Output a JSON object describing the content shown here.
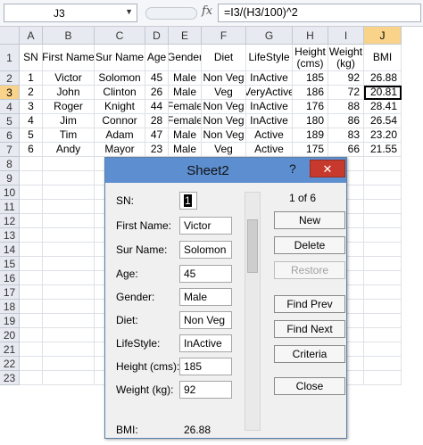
{
  "formula_bar": {
    "name_box": "J3",
    "fx": "fx",
    "formula": "=I3/(H3/100)^2"
  },
  "columns": [
    "A",
    "B",
    "C",
    "D",
    "E",
    "F",
    "G",
    "H",
    "I",
    "J"
  ],
  "rows": [
    "1",
    "2",
    "3",
    "4",
    "5",
    "6",
    "7",
    "8",
    "9",
    "10",
    "11",
    "12",
    "13",
    "14",
    "15",
    "16",
    "17",
    "18",
    "19",
    "20",
    "21",
    "22",
    "23"
  ],
  "table": {
    "headers": [
      "SN",
      "First Name",
      "Sur Name",
      "Age",
      "Gender",
      "Diet",
      "LifeStyle",
      "Height\n(cms)",
      "Weight\n(kg)",
      "BMI"
    ],
    "data": [
      [
        "1",
        "Victor",
        "Solomon",
        "45",
        "Male",
        "Non Veg",
        "InActive",
        "185",
        "92",
        "26.88"
      ],
      [
        "2",
        "John",
        "Clinton",
        "26",
        "Male",
        "Veg",
        "VeryActive",
        "186",
        "72",
        "20.81"
      ],
      [
        "3",
        "Roger",
        "Knight",
        "44",
        "Female",
        "Non Veg",
        "InActive",
        "176",
        "88",
        "28.41"
      ],
      [
        "4",
        "Jim",
        "Connor",
        "28",
        "Female",
        "Non Veg",
        "InActive",
        "180",
        "86",
        "26.54"
      ],
      [
        "5",
        "Tim",
        "Adam",
        "47",
        "Male",
        "Non Veg",
        "Active",
        "189",
        "83",
        "23.20"
      ],
      [
        "6",
        "Andy",
        "Mayor",
        "23",
        "Male",
        "Veg",
        "Active",
        "175",
        "66",
        "21.55"
      ]
    ]
  },
  "dialog": {
    "title": "Sheet2",
    "help": "?",
    "close": "✕",
    "record_count": "1 of 6",
    "fields": [
      {
        "label": "SN:",
        "value": "1"
      },
      {
        "label": "First Name:",
        "value": "Victor"
      },
      {
        "label": "Sur Name:",
        "value": "Solomon"
      },
      {
        "label": "Age:",
        "value": "45"
      },
      {
        "label": "Gender:",
        "value": "Male"
      },
      {
        "label": "Diet:",
        "value": "Non Veg"
      },
      {
        "label": "LifeStyle:",
        "value": "InActive"
      },
      {
        "label": "Height (cms):",
        "value": "185"
      },
      {
        "label": "Weight (kg):",
        "value": "92"
      }
    ],
    "bmi_label": "BMI:",
    "bmi_value": "26.88",
    "buttons": {
      "new": "New",
      "delete": "Delete",
      "restore": "Restore",
      "find_prev": "Find Prev",
      "find_next": "Find Next",
      "criteria": "Criteria",
      "close": "Close"
    }
  },
  "selection": {
    "column": "J",
    "row": "3"
  }
}
